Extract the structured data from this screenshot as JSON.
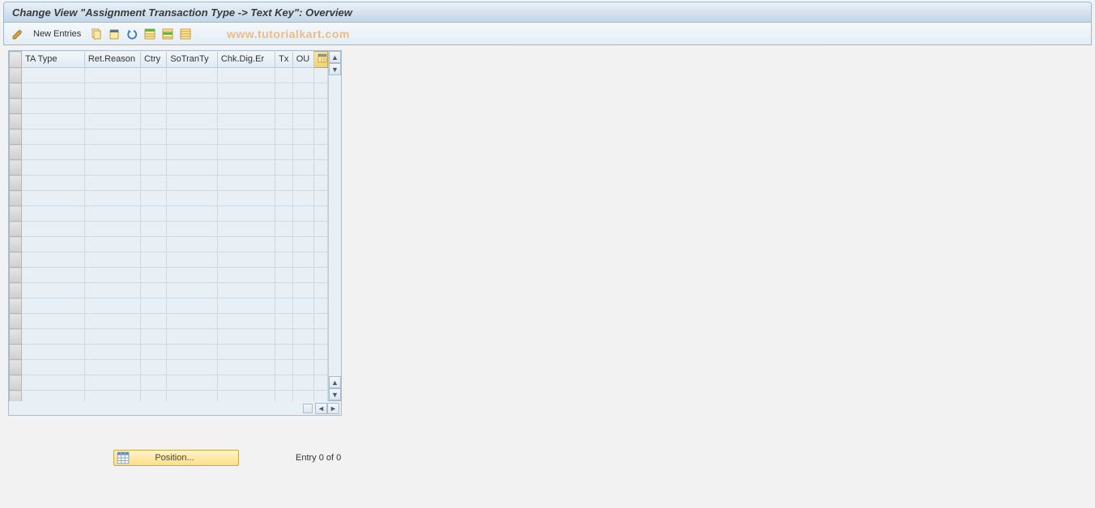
{
  "title": "Change View \"Assignment Transaction Type -> Text Key\": Overview",
  "toolbar": {
    "new_entries_label": "New Entries"
  },
  "watermark": "www.tutorialkart.com",
  "table": {
    "columns": {
      "ta_type": "TA Type",
      "ret_reason": "Ret.Reason",
      "ctry": "Ctry",
      "sotran": "SoTranTy",
      "chkdig": "Chk.Dig.Er",
      "tx": "Tx",
      "ou": "OU"
    },
    "row_count": 22
  },
  "footer": {
    "position_label": "Position...",
    "entry_text": "Entry 0 of 0"
  }
}
